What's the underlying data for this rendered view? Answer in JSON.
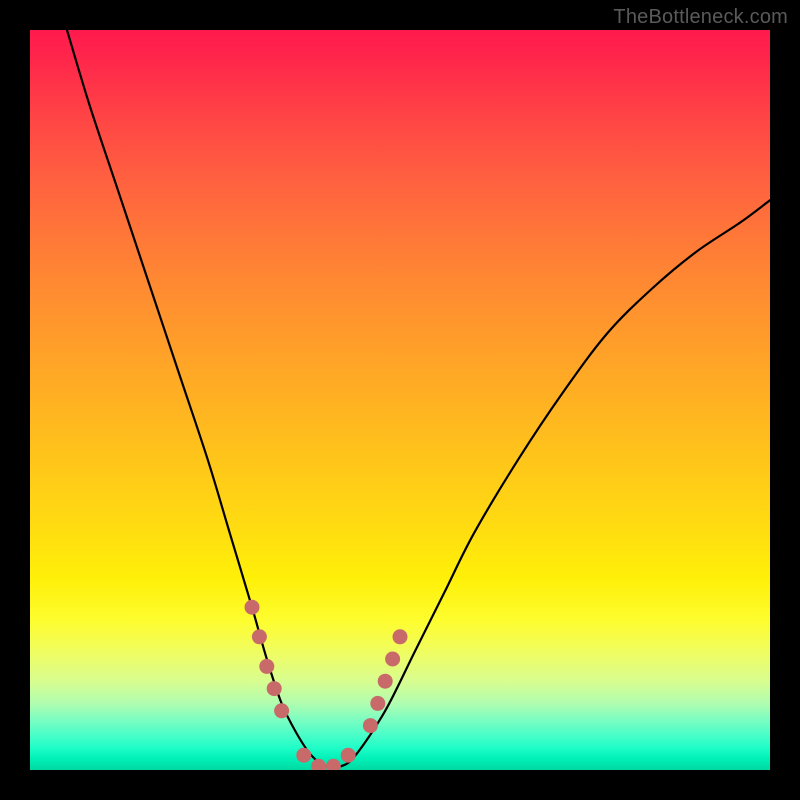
{
  "watermark": "TheBottleneck.com",
  "chart_data": {
    "type": "line",
    "title": "",
    "xlabel": "",
    "ylabel": "",
    "xlim": [
      0,
      100
    ],
    "ylim": [
      0,
      100
    ],
    "grid": false,
    "series": [
      {
        "name": "bottleneck-curve",
        "color": "#000000",
        "x": [
          5,
          8,
          12,
          16,
          20,
          24,
          27,
          30,
          32,
          34,
          36,
          38,
          40,
          42,
          44,
          48,
          52,
          56,
          60,
          66,
          72,
          78,
          84,
          90,
          96,
          100
        ],
        "y": [
          100,
          90,
          78,
          66,
          54,
          42,
          32,
          22,
          15,
          9,
          5,
          2,
          0.5,
          0.5,
          2,
          8,
          16,
          24,
          32,
          42,
          51,
          59,
          65,
          70,
          74,
          77
        ]
      }
    ],
    "markers": [
      {
        "name": "marker-left-cluster",
        "color": "#c86a6a",
        "x": [
          30,
          31,
          32,
          33,
          34
        ],
        "y": [
          22,
          18,
          14,
          11,
          8
        ]
      },
      {
        "name": "marker-valley-cluster",
        "color": "#c86a6a",
        "x": [
          37,
          39,
          41,
          43
        ],
        "y": [
          2,
          0.5,
          0.5,
          2
        ]
      },
      {
        "name": "marker-right-cluster",
        "color": "#c86a6a",
        "x": [
          46,
          47,
          48,
          49,
          50
        ],
        "y": [
          6,
          9,
          12,
          15,
          18
        ]
      }
    ]
  }
}
